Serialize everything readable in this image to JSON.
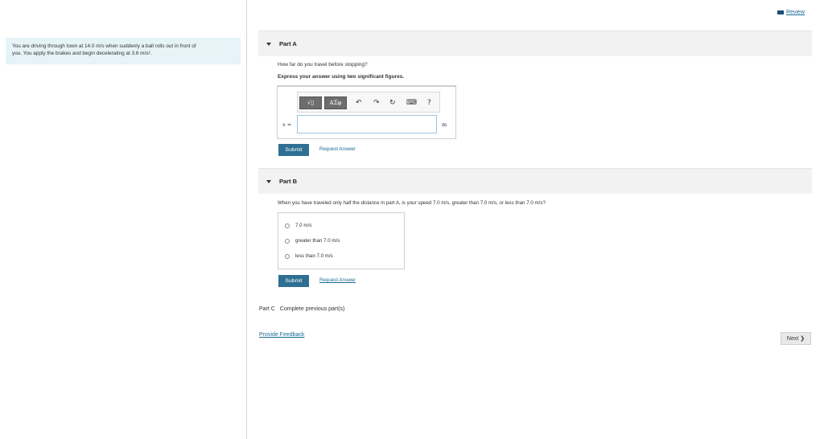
{
  "header": {
    "review_label": "Review"
  },
  "problem": {
    "line1": "You are driving through town at 14.0 m/s when suddenly a ball rolls out in front of",
    "line2": "you. You apply the brakes and begin decelerating at 3.6 m/s²."
  },
  "part_a": {
    "title": "Part A",
    "question": "How far do you travel before stopping?",
    "instruction": "Express your answer using two significant figures.",
    "toolbar": {
      "templates_label": "√▯",
      "greek_label": "ΑΣφ",
      "undo_label": "↶",
      "redo_label": "↷",
      "reset_label": "↻",
      "keyboard_label": "⌨",
      "help_label": "?"
    },
    "variable_label": "x =",
    "input_value": "",
    "unit": "m",
    "submit_label": "Submit",
    "request_label": "Request Answer"
  },
  "part_b": {
    "title": "Part B",
    "question": "When you have traveled only half the distance in part A, is your speed 7.0 m/s, greater than 7.0 m/s, or less than 7.0 m/s?",
    "options": [
      "7.0 m/s",
      "greater than 7.0 m/s",
      "less than 7.0 m/s"
    ],
    "submit_label": "Submit",
    "request_label": "Request Answer"
  },
  "part_c": {
    "title": "Part C",
    "status": "Complete previous part(s)"
  },
  "footer": {
    "feedback_label": "Provide Feedback",
    "next_label": "Next ❯"
  }
}
